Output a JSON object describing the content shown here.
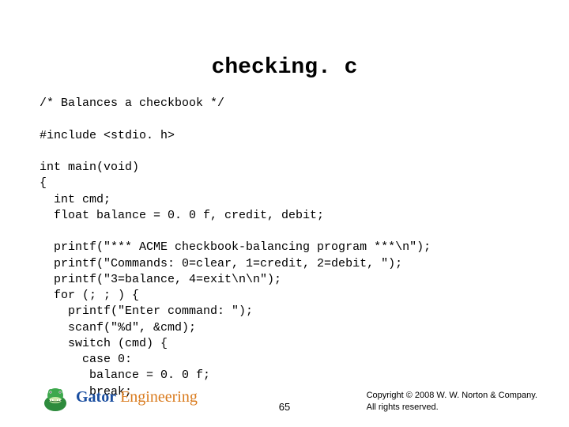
{
  "title": "checking. c",
  "code": "/* Balances a checkbook */\n\n#include <stdio. h>\n\nint main(void)\n{\n  int cmd;\n  float balance = 0. 0 f, credit, debit;\n\n  printf(\"*** ACME checkbook-balancing program ***\\n\");\n  printf(\"Commands: 0=clear, 1=credit, 2=debit, \");\n  printf(\"3=balance, 4=exit\\n\\n\");\n  for (; ; ) {\n    printf(\"Enter command: \");\n    scanf(\"%d\", &cmd);\n    switch (cmd) {\n      case 0:\n       balance = 0. 0 f;\n       break;",
  "footer": {
    "brand1": "Gator",
    "brand2": " Engineering",
    "page": "65",
    "copyright_line1": "Copyright © 2008 W. W. Norton & Company.",
    "copyright_line2": "All rights reserved."
  }
}
